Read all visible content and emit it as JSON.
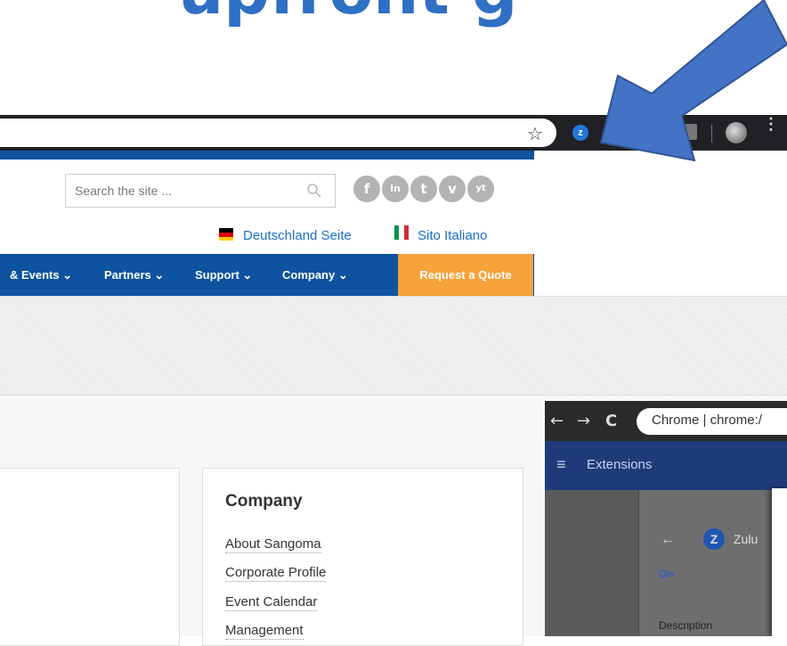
{
  "slide": {
    "title_fragment": "upfront g"
  },
  "browser": {
    "star_icon": "☆",
    "extension_icon_letter": "z",
    "menu_icon": "⋮"
  },
  "site": {
    "search_placeholder": "Search the site ...",
    "social": [
      "f",
      "in",
      "t",
      "v",
      "yt"
    ],
    "languages": [
      {
        "label": "Deutschland Seite"
      },
      {
        "label": "Sito Italiano"
      }
    ],
    "nav": [
      "& Events ⌄",
      "Partners ⌄",
      "Support ⌄",
      "Company ⌄"
    ],
    "request_quote": "Request a Quote",
    "company_heading": "Company",
    "company_links": [
      "About Sangoma",
      "Corporate Profile",
      "Event Calendar",
      "Management"
    ]
  },
  "inset": {
    "chrome_label": "Chrome | chrome:/",
    "extensions_title": "Extensions",
    "extension_name": "Zulu",
    "extension_letter": "Z",
    "status": "On",
    "description_label": "Description"
  },
  "colors": {
    "brand_blue": "#0d53a0",
    "quote_orange": "#f5a33a",
    "arrow_blue": "#4472c4"
  }
}
